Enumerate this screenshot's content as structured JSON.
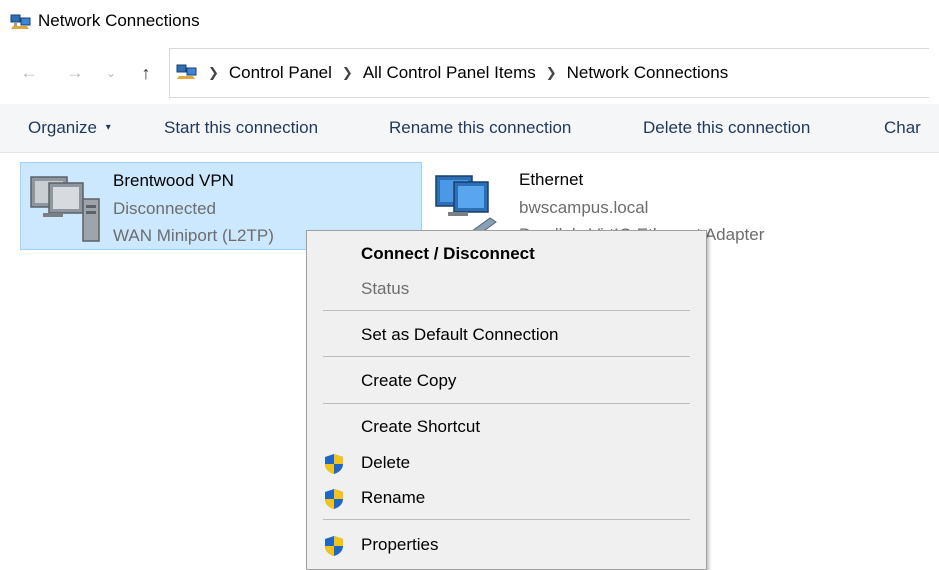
{
  "window": {
    "title": "Network Connections"
  },
  "address": {
    "breadcrumbs": [
      "Control Panel",
      "All Control Panel Items",
      "Network Connections"
    ]
  },
  "toolbar": {
    "organize": "Organize",
    "start": "Start this connection",
    "rename": "Rename this connection",
    "delete": "Delete this connection",
    "change": "Char"
  },
  "connections": [
    {
      "name": "Brentwood VPN",
      "status": "Disconnected",
      "device": "WAN Miniport (L2TP)"
    },
    {
      "name": "Ethernet",
      "status": "bwscampus.local",
      "device": "Parallels VirtIO Ethernet Adapter",
      "device_visible": "et Adapter"
    }
  ],
  "context_menu": {
    "items": [
      {
        "label": "Connect / Disconnect",
        "bold": true
      },
      {
        "label": "Status",
        "disabled": true
      },
      {
        "label": "Set as Default Connection"
      },
      {
        "label": "Create Copy"
      },
      {
        "label": "Create Shortcut"
      },
      {
        "label": "Delete",
        "shield": true
      },
      {
        "label": "Rename",
        "shield": true
      },
      {
        "label": "Properties",
        "shield": true
      }
    ]
  },
  "colors": {
    "selection_bg": "#cce8ff",
    "selection_border": "#99d1ff",
    "toolbar_text": "#1e395b",
    "menu_bg": "#f0f0f0"
  },
  "icons": {
    "title": "network-connections-icon",
    "back": "arrow-left-icon",
    "forward": "arrow-right-icon",
    "recent": "chevron-down-icon",
    "up": "arrow-up-icon",
    "uac": "uac-shield-icon"
  }
}
